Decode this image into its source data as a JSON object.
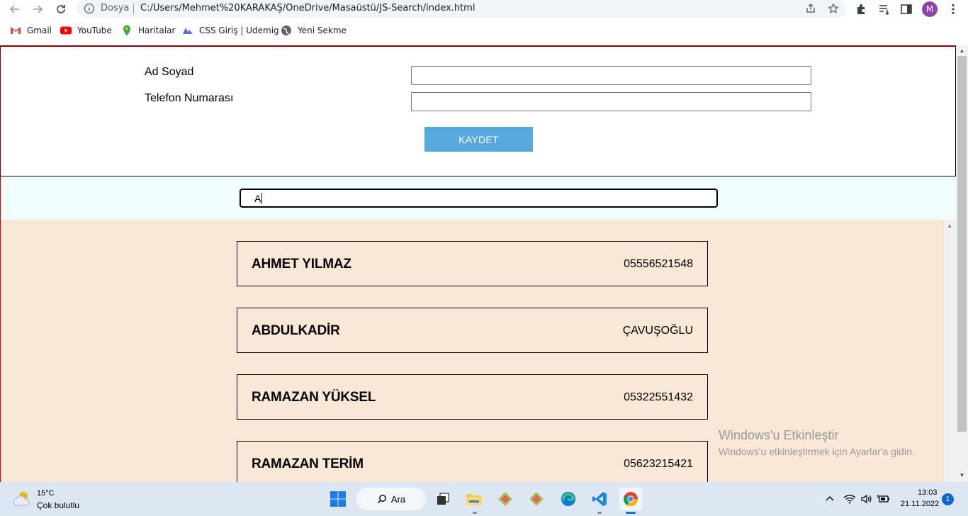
{
  "browser": {
    "omnibox": {
      "security_label": "Dosya",
      "url": "C:/Users/Mehmet%20KARAKAŞ/OneDrive/Masaüstü/JS-Search/index.html"
    },
    "profile_initial": "M",
    "bookmarks": [
      {
        "label": "Gmail",
        "icon": "gmail-icon"
      },
      {
        "label": "YouTube",
        "icon": "youtube-icon"
      },
      {
        "label": "Haritalar",
        "icon": "maps-icon"
      },
      {
        "label": "CSS Giriş | Udemig",
        "icon": "udemig-icon"
      },
      {
        "label": "Yeni Sekme",
        "icon": "globe-icon"
      }
    ]
  },
  "form": {
    "name_label": "Ad Soyad",
    "phone_label": "Telefon Numarası",
    "name_value": "",
    "phone_value": "",
    "save_label": "KAYDET"
  },
  "search": {
    "value": "A"
  },
  "contacts": [
    {
      "name": "AHMET YILMAZ",
      "phone": "05556521548"
    },
    {
      "name": "ABDULKADİR",
      "phone": "ÇAVUŞOĞLU"
    },
    {
      "name": "RAMAZAN YÜKSEL",
      "phone": "05322551432"
    },
    {
      "name": "RAMAZAN TERİM",
      "phone": "05623215421"
    }
  ],
  "watermark": {
    "title": "Windows'u Etkinleştir",
    "subtitle": "Windows'u etkinleştirmek için Ayarlar'a gidin."
  },
  "taskbar": {
    "weather_temp": "15°C",
    "weather_desc": "Çok bulutlu",
    "search_label": "Ara",
    "time": "13:03",
    "date": "21.11.2022",
    "notification_count": "1"
  }
}
